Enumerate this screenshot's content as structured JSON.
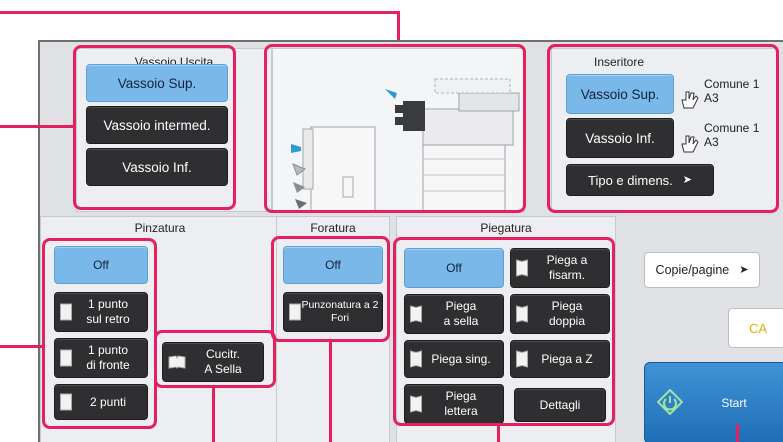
{
  "vassoio_uscita": {
    "title": "Vassoio Uscita",
    "buttons": [
      "Vassoio Sup.",
      "Vassoio intermed.",
      "Vassoio Inf."
    ]
  },
  "inseritore": {
    "title": "Inseritore",
    "upper_label": "Vassoio Sup.",
    "upper_info": {
      "line1": "Comune 1",
      "line2": "A3"
    },
    "lower_label": "Vassoio Inf.",
    "lower_info": {
      "line1": "Comune 1",
      "line2": "A3"
    },
    "tipo_label": "Tipo e dimens."
  },
  "pinzatura": {
    "title": "Pinzatura",
    "off": "Off",
    "opt1": "1 punto\nsul retro",
    "opt2": "1 punto\ndi fronte",
    "opt3": "2 punti",
    "saddle": "Cucitr.\nA Sella"
  },
  "foratura": {
    "title": "Foratura",
    "off": "Off",
    "opt1": "Punzonatura a 2\nFori"
  },
  "piegatura": {
    "title": "Piegatura",
    "off": "Off",
    "fisarm": "Piega a\nfisarm.",
    "sella": "Piega\na sella",
    "doppia": "Piega\ndoppia",
    "singola": "Piega sing.",
    "z": "Piega a Z",
    "lettera": "Piega\nlettera",
    "dettagli": "Dettagli"
  },
  "right": {
    "copie": "Copie/pagine",
    "ca": "CA",
    "start": "Start"
  },
  "colors": {
    "highlight": "#e4205f",
    "selected": "#7ab8ea",
    "button": "#2f2f31",
    "start": "#1f6eb6",
    "ca_text": "#e0b000"
  }
}
